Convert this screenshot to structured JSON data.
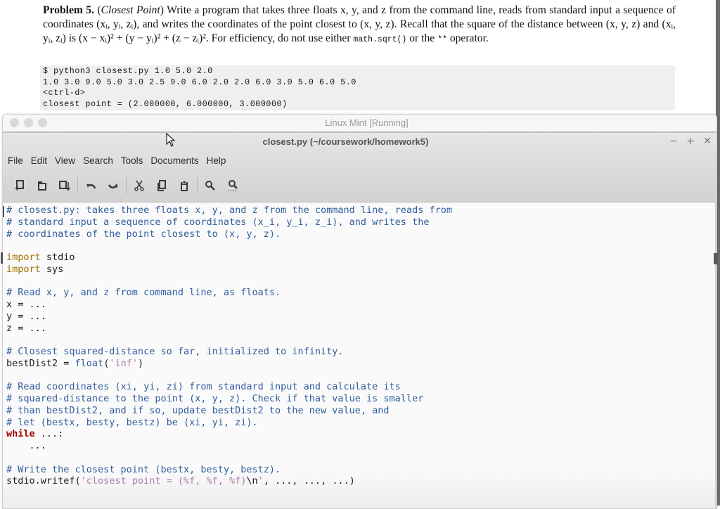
{
  "document": {
    "problem_label": "Problem 5.",
    "problem_title": "Closest Point",
    "problem_text_1": " Write a program that takes three floats x, y, and z from the command line, reads from standard input a sequence of coordinates (x",
    "problem_paragraph": [
      "Write a program that takes three floats x, y, and z from the command line, reads from standard input a sequence of coordinates (xᵢ, yᵢ, zᵢ), and writes the coordinates of the point closest to (x, y, z). Recall that the square of the distance between (x, y, z) and (xᵢ, yᵢ, zᵢ) is (x − xᵢ)² + (y − yᵢ)² + (z − zᵢ)². For efficiency, do not use either",
      "math.sqrt()",
      "or the",
      "**",
      "operator."
    ],
    "console_lines": [
      "$ python3 closest.py 1.0 5.0 2.0",
      "1.0 3.0 9.0 5.0 3.0 2.5 9.0 6.0 2.0 2.0 6.0 3.0 5.0 6.0 5.0",
      "<ctrl-d>",
      "closest point = (2.000000, 6.000000, 3.000000)"
    ]
  },
  "vm_window": {
    "title": "Linux Mint [Running]",
    "controls": [
      "close",
      "minimize",
      "zoom"
    ]
  },
  "editor_window": {
    "title": "closest.py (~/coursework/homework5)",
    "wm_buttons": {
      "minimize": "−",
      "maximize": "+",
      "close": "✕"
    },
    "menu": [
      "File",
      "Edit",
      "View",
      "Search",
      "Tools",
      "Documents",
      "Help"
    ],
    "toolbar": [
      {
        "icon": "new-document-icon",
        "label": "New"
      },
      {
        "icon": "open-icon",
        "label": "Open"
      },
      {
        "icon": "save-icon",
        "label": "Save"
      },
      {
        "icon": "undo-icon",
        "label": "Undo"
      },
      {
        "icon": "redo-icon",
        "label": "Redo"
      },
      {
        "icon": "cut-icon",
        "label": "Cut"
      },
      {
        "icon": "copy-icon",
        "label": "Copy"
      },
      {
        "icon": "paste-icon",
        "label": "Paste"
      },
      {
        "icon": "search-icon",
        "label": "Find"
      },
      {
        "icon": "search-replace-icon",
        "label": "Find and Replace"
      }
    ]
  },
  "code": {
    "line1": "# closest.py: takes three floats x, y, and z from the command line, reads from",
    "line2": "# standard input a sequence of coordinates (x_i, y_i, z_i), and writes the",
    "line3": "# coordinates of the point closest to (x, y, z).",
    "line5_kw": "import",
    "line5_rest": " stdio",
    "line6_kw": "import",
    "line6_rest": " sys",
    "line8": "# Read x, y, and z from command line, as floats.",
    "line9": "x = ...",
    "line10": "y = ...",
    "line11": "z = ...",
    "line13": "# Closest squared-distance so far, initialized to infinity.",
    "line14_a": "bestDist2 = ",
    "line14_fn": "float",
    "line14_b": "(",
    "line14_str": "'inf'",
    "line14_c": ")",
    "line16": "# Read coordinates (xi, yi, zi) from standard input and calculate its",
    "line17": "# squared-distance to the point (x, y, z). Check if that value is smaller",
    "line18": "# than bestDist2, and if so, update bestDist2 to the new value, and",
    "line19": "# let (bestx, besty, bestz) be (xi, yi, zi).",
    "line20_kw": "while",
    "line20_rest": " ...:",
    "line21": "    ...",
    "line23": "# Write the closest point (bestx, besty, bestz).",
    "line24_a": "stdio.writef(",
    "line24_str": "'closest point = (%f, %f, %f)",
    "line24_esc": "\\n",
    "line24_str2": "'",
    "line24_b": ", ..., ..., ...)"
  }
}
